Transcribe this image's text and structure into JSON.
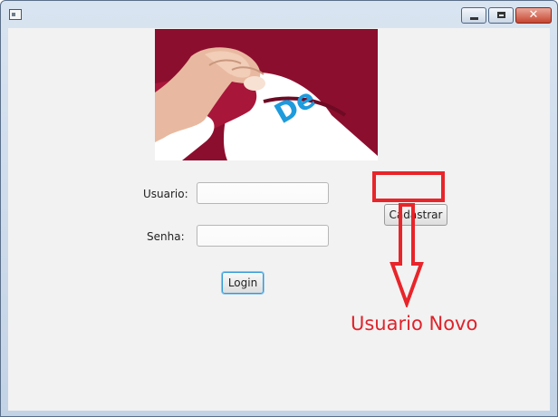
{
  "window": {
    "title": ""
  },
  "banner": {
    "overlay_text": "De",
    "overlay_color": "#1e9bdc"
  },
  "form": {
    "username_label": "Usuario:",
    "username_value": "",
    "password_label": "Senha:",
    "password_value": "",
    "login_label": "Login",
    "register_label": "Cadastrar"
  },
  "annotation": {
    "text": "Usuario Novo",
    "color": "#e0222a"
  }
}
